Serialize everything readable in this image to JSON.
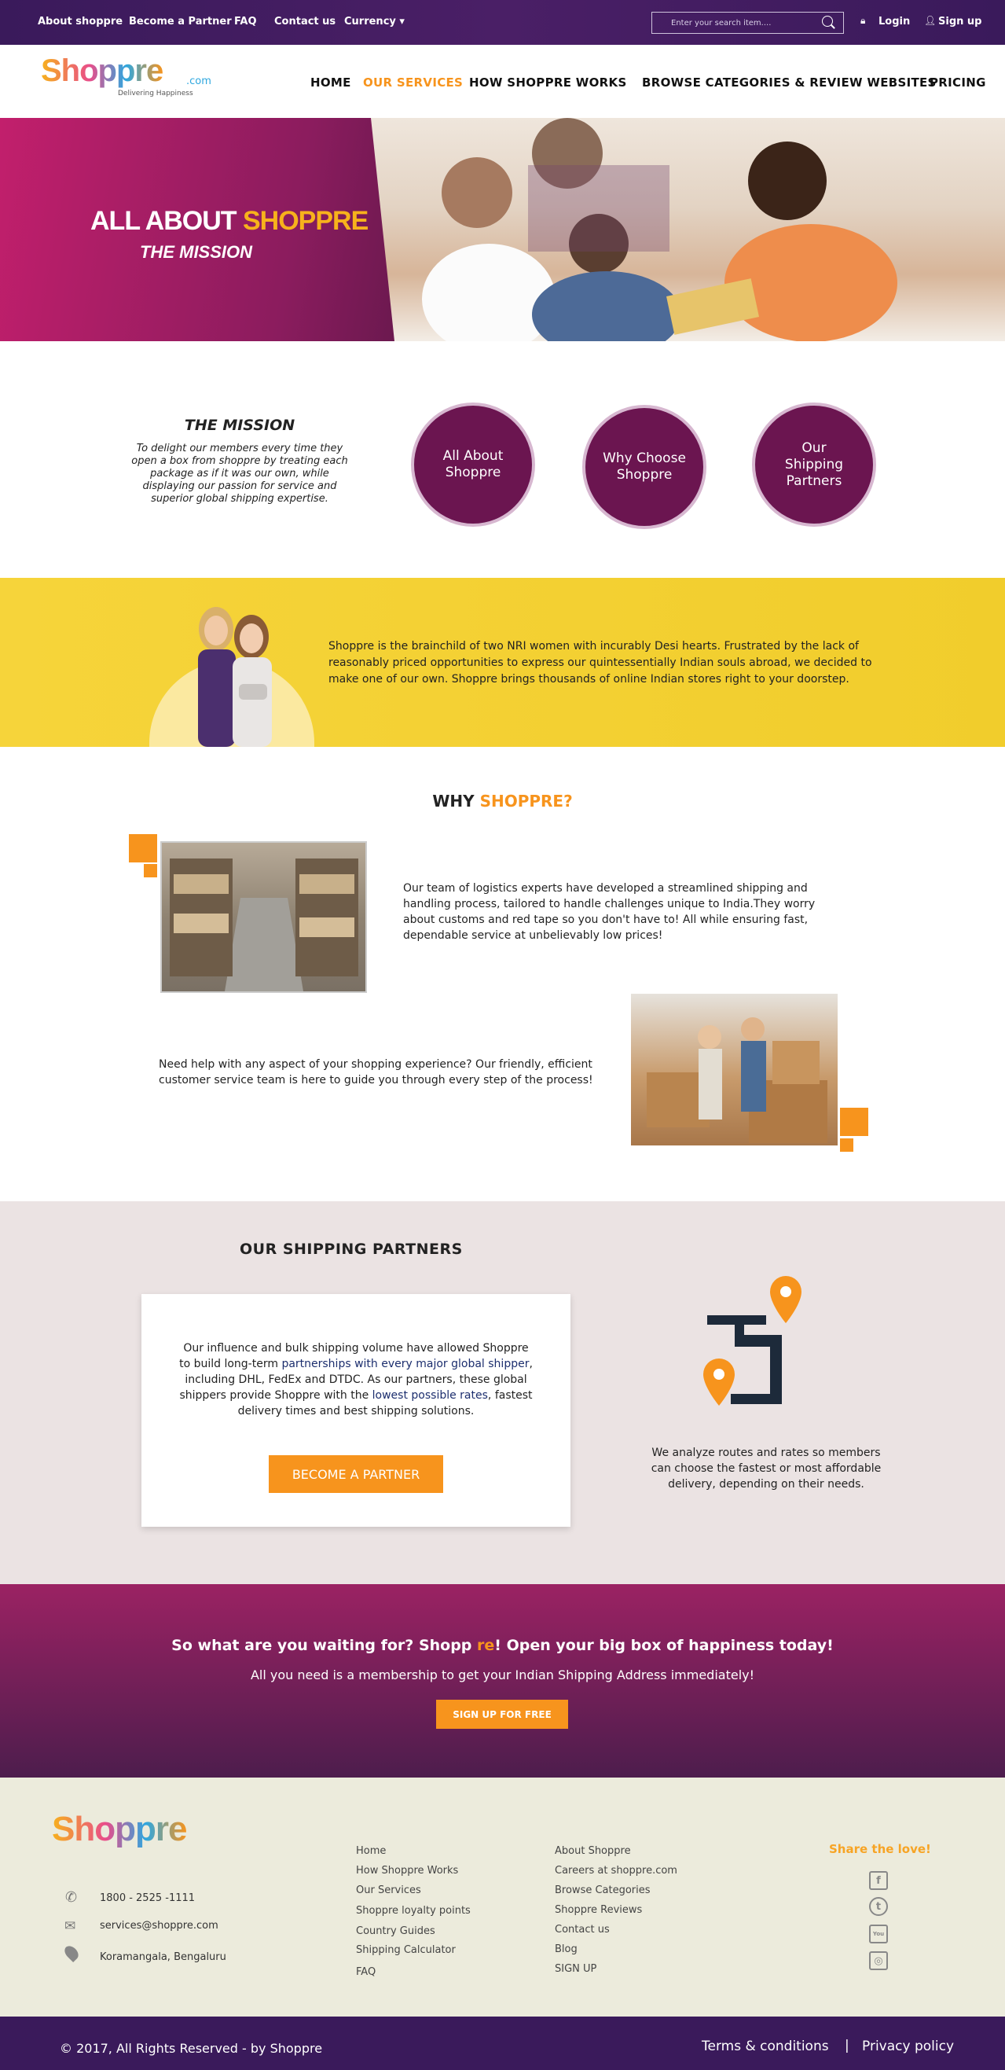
{
  "topbar": {
    "links": [
      "About shoppre",
      "Become a Partner",
      "FAQ",
      "Contact us",
      "Currency ▾"
    ],
    "search_placeholder": "Enter your search item....",
    "login": "Login",
    "signup": "Sign up"
  },
  "logo": {
    "brand": "Shoppre",
    "tld": ".com",
    "tagline": "Delivering Happiness"
  },
  "nav": {
    "home": "HOME",
    "services": "OUR SERVICES",
    "how": "HOW  SHOPPRE  WORKS",
    "browse": "BROWSE CATEGORIES & REVIEW WEBSITES",
    "pricing": "PRICING"
  },
  "hero": {
    "title_white": "ALL ABOUT ",
    "title_orange": "SHOPPRE",
    "subtitle": "THE MISSION"
  },
  "mission": {
    "title": "THE MISSION",
    "text": "To delight our members every time they open a box from shoppre by treating each package as if it was our own, while displaying our passion for service and superior global shipping expertise.",
    "circles": [
      "All About Shoppre",
      "Why Choose Shoppre",
      "Our Shipping Partners"
    ]
  },
  "about": {
    "text": "Shoppre is the brainchild of two NRI women with incurably Desi hearts. Frustrated by the lack of reasonably priced opportunities to express our quintessentially Indian souls abroad, we decided to make one of our own. Shoppre brings thousands of online Indian stores right to your doorstep."
  },
  "why": {
    "title_black": "WHY ",
    "title_orange": "SHOPPRE?",
    "text1": "Our team of logistics experts have developed a streamlined shipping and handling process, tailored to handle challenges unique to India.They worry about customs and red tape so you don't have to! All while ensuring fast, dependable service at unbelievably low prices!",
    "text2": "Need help with any aspect of your shopping experience? Our friendly, efficient customer service team is here to guide you through every step of the process!"
  },
  "partners": {
    "title": "OUR SHIPPING PARTNERS",
    "text_a": "Our influence and bulk shipping volume have allowed Shoppre to build long-term ",
    "text_hl1": "partnerships with every major global shipper",
    "text_b": ", including DHL, FedEx and DTDC. As our partners, these global shippers provide Shoppre with the ",
    "text_hl2": "lowest possible rates",
    "text_c": ", fastest delivery times and best shipping solutions.",
    "button": "BECOME A PARTNER",
    "route_text": "We analyze routes and rates so members can choose the fastest or most affordable delivery, depending on their needs."
  },
  "cta": {
    "title_a": "So what are you waiting for? Shopp ",
    "title_re": "re",
    "title_b": "! Open your big box of happiness today!",
    "subtitle": "All you need is a membership to get your Indian Shipping Address immediately!",
    "button": "SIGN UP FOR FREE"
  },
  "footer": {
    "phone": "1800 - 2525 -1111",
    "email": "services@shoppre.com",
    "location": "Koramangala, Bengaluru",
    "col1": [
      "Home",
      "How Shoppre Works",
      "Our Services",
      "Shoppre loyalty points",
      "Country Guides",
      "Shipping Calculator",
      "FAQ"
    ],
    "col2": [
      "About Shoppre",
      "Careers at shoppre.com",
      "Browse Categories",
      "Shoppre Reviews",
      "Contact us",
      "Blog",
      "SIGN UP"
    ],
    "share": "Share the love!",
    "social": [
      "f",
      "t",
      "You",
      "◎"
    ],
    "copyright": "©  2017, All Rights Reserved - by Shoppre",
    "terms": "Terms & conditions",
    "separator": "|",
    "privacy": "Privacy policy"
  },
  "colors": {
    "purple": "#3a1a5b",
    "orange": "#f7941d",
    "yellow": "#f3d12e",
    "plum": "#6b1550"
  }
}
